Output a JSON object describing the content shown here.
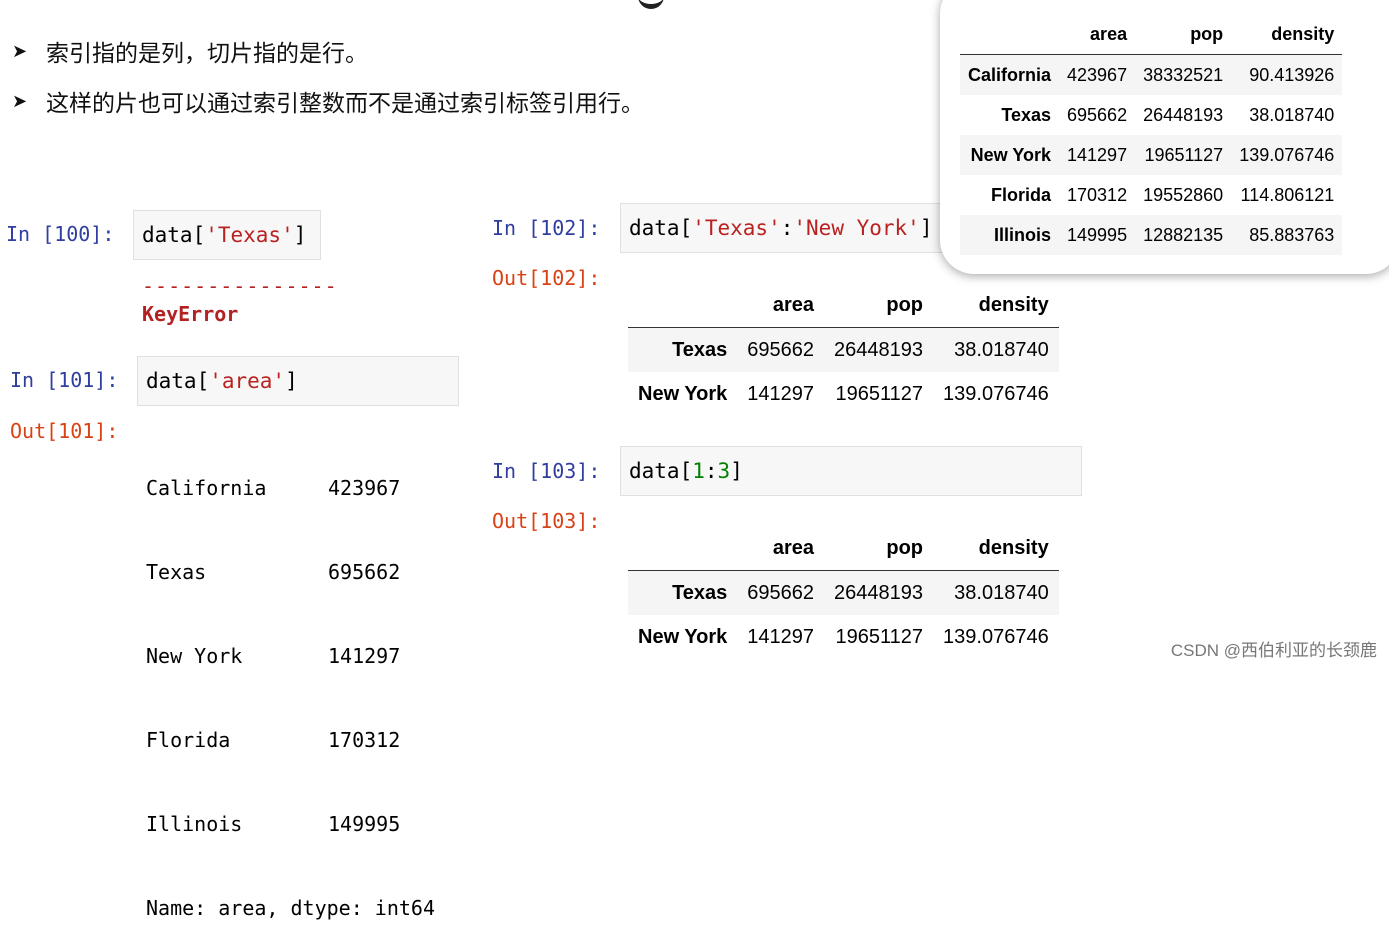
{
  "bullets": [
    "索引指的是列，切片指的是行。",
    "这样的片也可以通过索引整数而不是通过索引标签引用行。"
  ],
  "cells": {
    "c100": {
      "prompt": "In [100]:",
      "code_pre": "data[",
      "code_str": "'Texas'",
      "code_post": "]",
      "error_line": "---------------",
      "error": "KeyError"
    },
    "c101": {
      "prompt": "In [101]:",
      "out_prompt": "Out[101]:",
      "code_pre": "data[",
      "code_str": "'area'",
      "code_post": "]",
      "series": [
        {
          "name": "California",
          "value": "423967"
        },
        {
          "name": "Texas",
          "value": "695662"
        },
        {
          "name": "New York",
          "value": "141297"
        },
        {
          "name": "Florida",
          "value": "170312"
        },
        {
          "name": "Illinois",
          "value": "149995"
        }
      ],
      "footer": "Name: area, dtype: int64"
    },
    "c102": {
      "prompt": "In [102]:",
      "out_prompt": "Out[102]:",
      "code_pre": "data[",
      "code_str1": "'Texas'",
      "colon": ":",
      "code_str2": "'New York'",
      "code_post": "]"
    },
    "c103": {
      "prompt": "In [103]:",
      "out_prompt": "Out[103]:",
      "code_pre": "data[",
      "num1": "1",
      "colon": ":",
      "num2": "3",
      "code_post": "]"
    }
  },
  "headers": [
    "area",
    "pop",
    "density"
  ],
  "table_slice": [
    {
      "idx": "Texas",
      "area": "695662",
      "pop": "26448193",
      "density": "38.018740"
    },
    {
      "idx": "New York",
      "area": "141297",
      "pop": "19651127",
      "density": "139.076746"
    }
  ],
  "table_full": [
    {
      "idx": "California",
      "area": "423967",
      "pop": "38332521",
      "density": "90.413926"
    },
    {
      "idx": "Texas",
      "area": "695662",
      "pop": "26448193",
      "density": "38.018740"
    },
    {
      "idx": "New York",
      "area": "141297",
      "pop": "19651127",
      "density": "139.076746"
    },
    {
      "idx": "Florida",
      "area": "170312",
      "pop": "19552860",
      "density": "114.806121"
    },
    {
      "idx": "Illinois",
      "area": "149995",
      "pop": "12882135",
      "density": "85.883763"
    }
  ],
  "watermark": "CSDN @西伯利亚的长颈鹿"
}
